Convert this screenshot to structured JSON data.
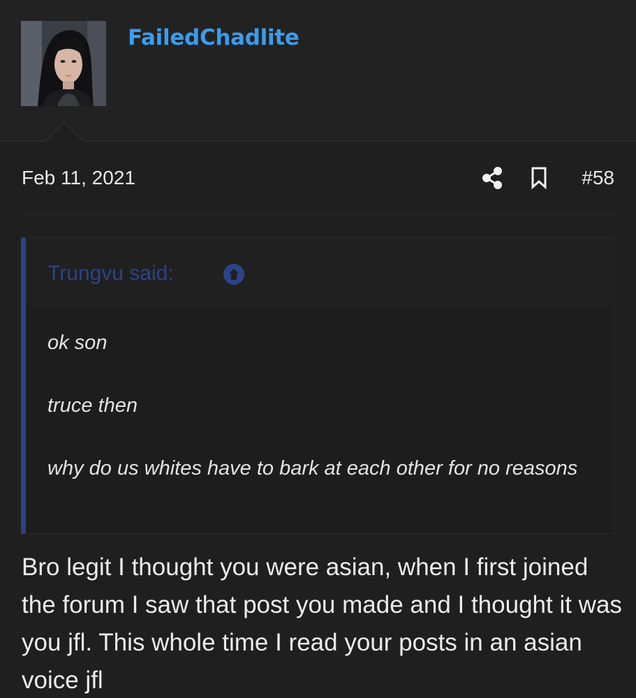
{
  "post": {
    "author": "FailedChadlite",
    "date": "Feb 11, 2021",
    "number": "#58",
    "icons": {
      "share": "share-icon",
      "bookmark": "bookmark-icon",
      "quote_up": "arrow-circle-up-icon"
    },
    "quote": {
      "attribution": "Trungvu said:",
      "lines": [
        "ok son",
        "truce then",
        "why do us whites have to bark at each other for no reasons"
      ]
    },
    "body": "Bro legit I thought you were asian, when I first joined the forum I saw that post you made and I thought it was you jfl. This whole time I read your posts in an asian voice jfl"
  },
  "colors": {
    "background": "#1f1f20",
    "username": "#3c9bec",
    "quote_accent": "#2d4282",
    "text": "#e9e9ea"
  }
}
